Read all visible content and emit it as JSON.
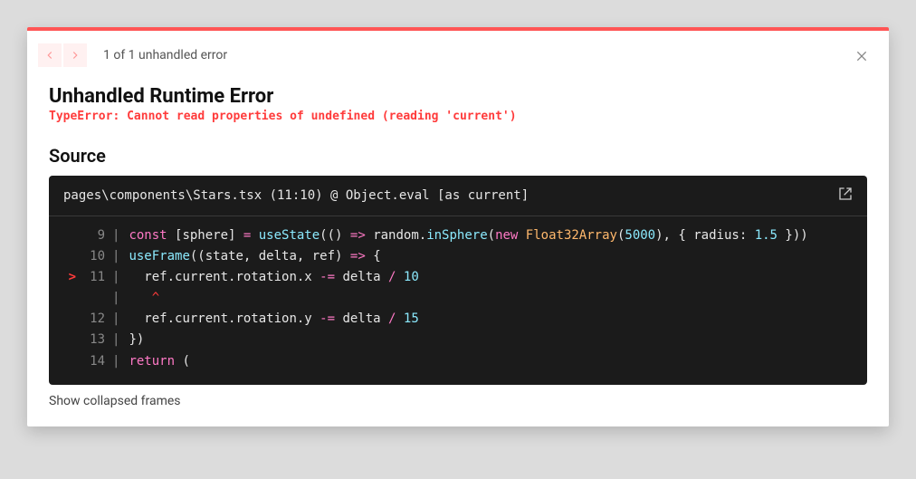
{
  "nav": {
    "counter": "1 of 1 unhandled error"
  },
  "title": "Unhandled Runtime Error",
  "error_message": "TypeError: Cannot read properties of undefined (reading 'current')",
  "source_heading": "Source",
  "stack_location": "pages\\components\\Stars.tsx (11:10) @ Object.eval [as current]",
  "code": {
    "error_line": 11,
    "lines": [
      {
        "n": 9,
        "tokens": [
          {
            "t": "const ",
            "c": "tok-kw"
          },
          {
            "t": "[sphere] "
          },
          {
            "t": "= ",
            "c": "tok-op"
          },
          {
            "t": "useState",
            "c": "tok-fn"
          },
          {
            "t": "(() "
          },
          {
            "t": "=> ",
            "c": "tok-op"
          },
          {
            "t": "random."
          },
          {
            "t": "inSphere",
            "c": "tok-fn"
          },
          {
            "t": "("
          },
          {
            "t": "new ",
            "c": "tok-kw"
          },
          {
            "t": "Float32Array",
            "c": "tok-type"
          },
          {
            "t": "("
          },
          {
            "t": "5000",
            "c": "tok-num"
          },
          {
            "t": "), { radius: "
          },
          {
            "t": "1.5",
            "c": "tok-num"
          },
          {
            "t": " }))"
          }
        ]
      },
      {
        "n": 10,
        "tokens": [
          {
            "t": "useFrame",
            "c": "tok-fn"
          },
          {
            "t": "((state, delta, ref) "
          },
          {
            "t": "=> ",
            "c": "tok-op"
          },
          {
            "t": "{"
          }
        ]
      },
      {
        "n": 11,
        "tokens": [
          {
            "t": "  ref.current.rotation.x "
          },
          {
            "t": "-= ",
            "c": "tok-op"
          },
          {
            "t": "delta "
          },
          {
            "t": "/ ",
            "c": "tok-op"
          },
          {
            "t": "10",
            "c": "tok-num"
          }
        ]
      },
      {
        "n": null,
        "caret": true,
        "tokens": [
          {
            "t": "   ^"
          }
        ]
      },
      {
        "n": 12,
        "tokens": [
          {
            "t": "  ref.current.rotation.y "
          },
          {
            "t": "-= ",
            "c": "tok-op"
          },
          {
            "t": "delta "
          },
          {
            "t": "/ ",
            "c": "tok-op"
          },
          {
            "t": "15",
            "c": "tok-num"
          }
        ]
      },
      {
        "n": 13,
        "tokens": [
          {
            "t": "})"
          }
        ]
      },
      {
        "n": 14,
        "tokens": [
          {
            "t": "return ",
            "c": "tok-kw"
          },
          {
            "t": "("
          }
        ]
      }
    ]
  },
  "show_frames": "Show collapsed frames"
}
